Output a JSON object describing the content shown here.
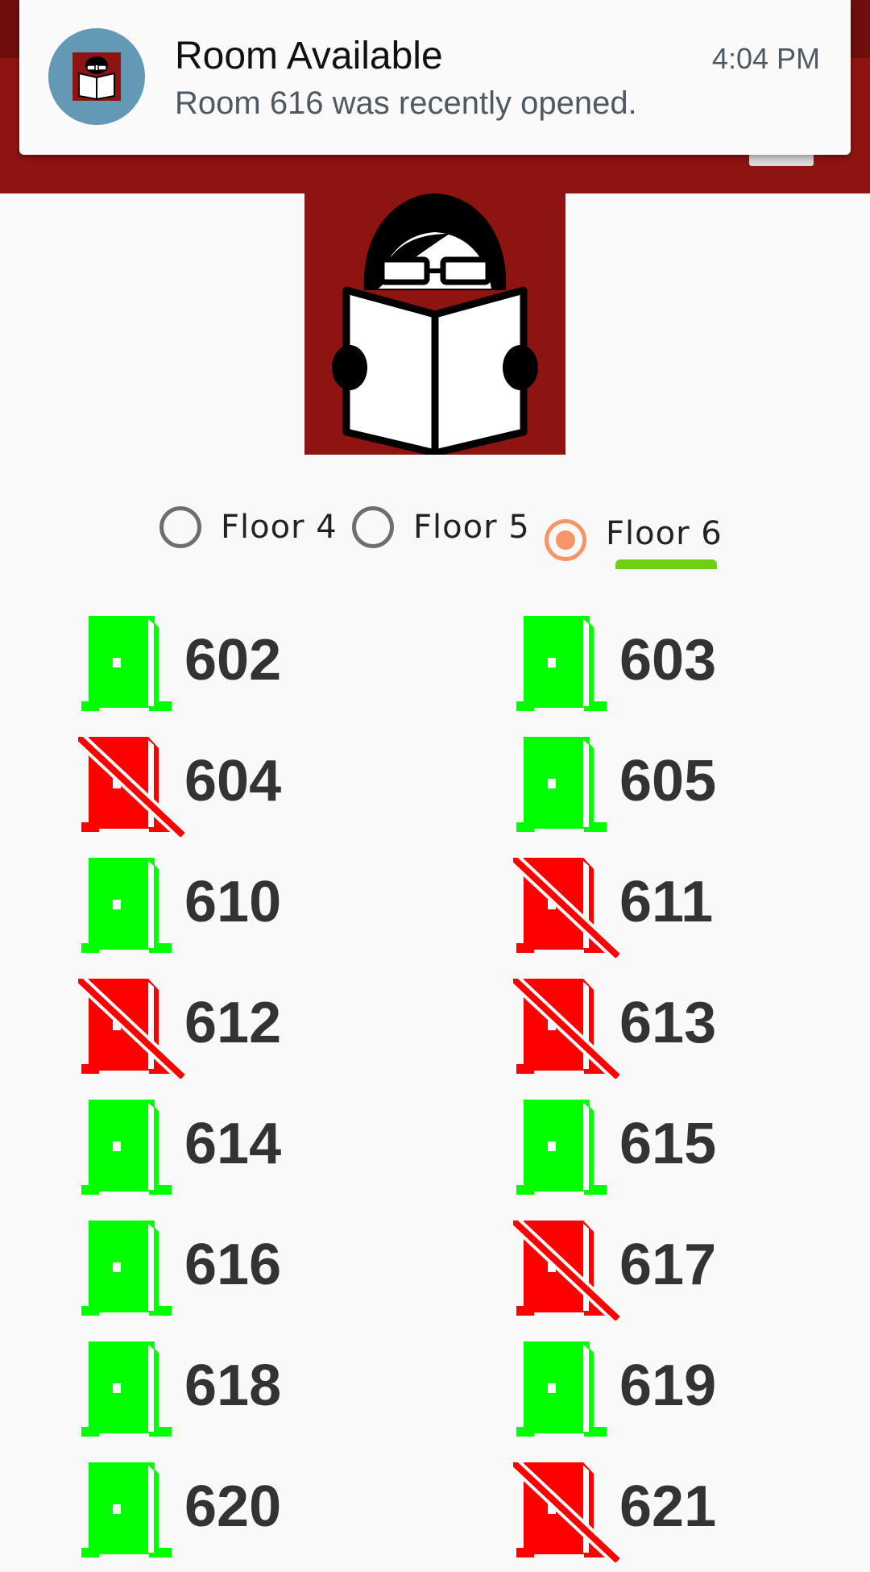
{
  "notification": {
    "title": "Room Available",
    "text": "Room 616 was recently opened.",
    "time": "4:04 PM"
  },
  "floors": [
    {
      "label": "Floor 4",
      "selected": false
    },
    {
      "label": "Floor 5",
      "selected": false
    },
    {
      "label": "Floor 6",
      "selected": true
    }
  ],
  "rooms": [
    {
      "number": "602",
      "available": true
    },
    {
      "number": "603",
      "available": true
    },
    {
      "number": "604",
      "available": false
    },
    {
      "number": "605",
      "available": true
    },
    {
      "number": "610",
      "available": true
    },
    {
      "number": "611",
      "available": false
    },
    {
      "number": "612",
      "available": false
    },
    {
      "number": "613",
      "available": false
    },
    {
      "number": "614",
      "available": true
    },
    {
      "number": "615",
      "available": true
    },
    {
      "number": "616",
      "available": true
    },
    {
      "number": "617",
      "available": false
    },
    {
      "number": "618",
      "available": true
    },
    {
      "number": "619",
      "available": true
    },
    {
      "number": "620",
      "available": true
    },
    {
      "number": "621",
      "available": false
    }
  ],
  "colors": {
    "brand": "#8e1411",
    "available": "#00ff00",
    "unavailable": "#ff0000",
    "radio_selected": "#f79469"
  }
}
